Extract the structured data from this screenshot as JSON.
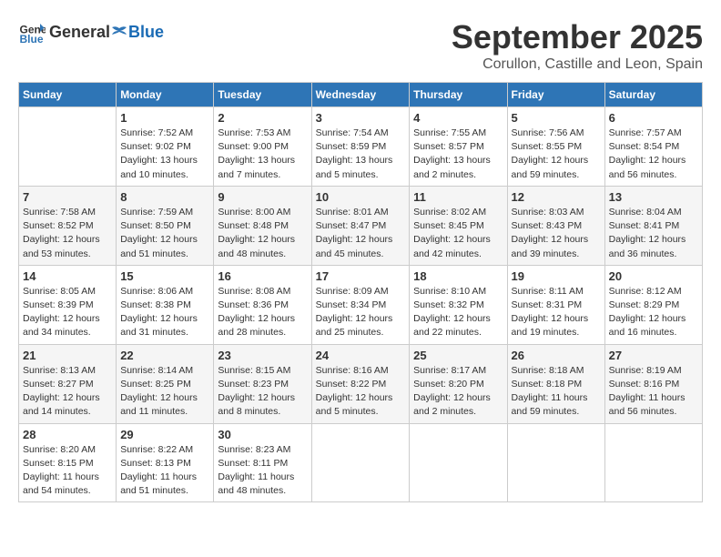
{
  "logo": {
    "general": "General",
    "blue": "Blue"
  },
  "title": "September 2025",
  "location": "Corullon, Castille and Leon, Spain",
  "weekdays": [
    "Sunday",
    "Monday",
    "Tuesday",
    "Wednesday",
    "Thursday",
    "Friday",
    "Saturday"
  ],
  "weeks": [
    [
      {
        "day": "",
        "info": ""
      },
      {
        "day": "1",
        "info": "Sunrise: 7:52 AM\nSunset: 9:02 PM\nDaylight: 13 hours\nand 10 minutes."
      },
      {
        "day": "2",
        "info": "Sunrise: 7:53 AM\nSunset: 9:00 PM\nDaylight: 13 hours\nand 7 minutes."
      },
      {
        "day": "3",
        "info": "Sunrise: 7:54 AM\nSunset: 8:59 PM\nDaylight: 13 hours\nand 5 minutes."
      },
      {
        "day": "4",
        "info": "Sunrise: 7:55 AM\nSunset: 8:57 PM\nDaylight: 13 hours\nand 2 minutes."
      },
      {
        "day": "5",
        "info": "Sunrise: 7:56 AM\nSunset: 8:55 PM\nDaylight: 12 hours\nand 59 minutes."
      },
      {
        "day": "6",
        "info": "Sunrise: 7:57 AM\nSunset: 8:54 PM\nDaylight: 12 hours\nand 56 minutes."
      }
    ],
    [
      {
        "day": "7",
        "info": "Sunrise: 7:58 AM\nSunset: 8:52 PM\nDaylight: 12 hours\nand 53 minutes."
      },
      {
        "day": "8",
        "info": "Sunrise: 7:59 AM\nSunset: 8:50 PM\nDaylight: 12 hours\nand 51 minutes."
      },
      {
        "day": "9",
        "info": "Sunrise: 8:00 AM\nSunset: 8:48 PM\nDaylight: 12 hours\nand 48 minutes."
      },
      {
        "day": "10",
        "info": "Sunrise: 8:01 AM\nSunset: 8:47 PM\nDaylight: 12 hours\nand 45 minutes."
      },
      {
        "day": "11",
        "info": "Sunrise: 8:02 AM\nSunset: 8:45 PM\nDaylight: 12 hours\nand 42 minutes."
      },
      {
        "day": "12",
        "info": "Sunrise: 8:03 AM\nSunset: 8:43 PM\nDaylight: 12 hours\nand 39 minutes."
      },
      {
        "day": "13",
        "info": "Sunrise: 8:04 AM\nSunset: 8:41 PM\nDaylight: 12 hours\nand 36 minutes."
      }
    ],
    [
      {
        "day": "14",
        "info": "Sunrise: 8:05 AM\nSunset: 8:39 PM\nDaylight: 12 hours\nand 34 minutes."
      },
      {
        "day": "15",
        "info": "Sunrise: 8:06 AM\nSunset: 8:38 PM\nDaylight: 12 hours\nand 31 minutes."
      },
      {
        "day": "16",
        "info": "Sunrise: 8:08 AM\nSunset: 8:36 PM\nDaylight: 12 hours\nand 28 minutes."
      },
      {
        "day": "17",
        "info": "Sunrise: 8:09 AM\nSunset: 8:34 PM\nDaylight: 12 hours\nand 25 minutes."
      },
      {
        "day": "18",
        "info": "Sunrise: 8:10 AM\nSunset: 8:32 PM\nDaylight: 12 hours\nand 22 minutes."
      },
      {
        "day": "19",
        "info": "Sunrise: 8:11 AM\nSunset: 8:31 PM\nDaylight: 12 hours\nand 19 minutes."
      },
      {
        "day": "20",
        "info": "Sunrise: 8:12 AM\nSunset: 8:29 PM\nDaylight: 12 hours\nand 16 minutes."
      }
    ],
    [
      {
        "day": "21",
        "info": "Sunrise: 8:13 AM\nSunset: 8:27 PM\nDaylight: 12 hours\nand 14 minutes."
      },
      {
        "day": "22",
        "info": "Sunrise: 8:14 AM\nSunset: 8:25 PM\nDaylight: 12 hours\nand 11 minutes."
      },
      {
        "day": "23",
        "info": "Sunrise: 8:15 AM\nSunset: 8:23 PM\nDaylight: 12 hours\nand 8 minutes."
      },
      {
        "day": "24",
        "info": "Sunrise: 8:16 AM\nSunset: 8:22 PM\nDaylight: 12 hours\nand 5 minutes."
      },
      {
        "day": "25",
        "info": "Sunrise: 8:17 AM\nSunset: 8:20 PM\nDaylight: 12 hours\nand 2 minutes."
      },
      {
        "day": "26",
        "info": "Sunrise: 8:18 AM\nSunset: 8:18 PM\nDaylight: 11 hours\nand 59 minutes."
      },
      {
        "day": "27",
        "info": "Sunrise: 8:19 AM\nSunset: 8:16 PM\nDaylight: 11 hours\nand 56 minutes."
      }
    ],
    [
      {
        "day": "28",
        "info": "Sunrise: 8:20 AM\nSunset: 8:15 PM\nDaylight: 11 hours\nand 54 minutes."
      },
      {
        "day": "29",
        "info": "Sunrise: 8:22 AM\nSunset: 8:13 PM\nDaylight: 11 hours\nand 51 minutes."
      },
      {
        "day": "30",
        "info": "Sunrise: 8:23 AM\nSunset: 8:11 PM\nDaylight: 11 hours\nand 48 minutes."
      },
      {
        "day": "",
        "info": ""
      },
      {
        "day": "",
        "info": ""
      },
      {
        "day": "",
        "info": ""
      },
      {
        "day": "",
        "info": ""
      }
    ]
  ]
}
